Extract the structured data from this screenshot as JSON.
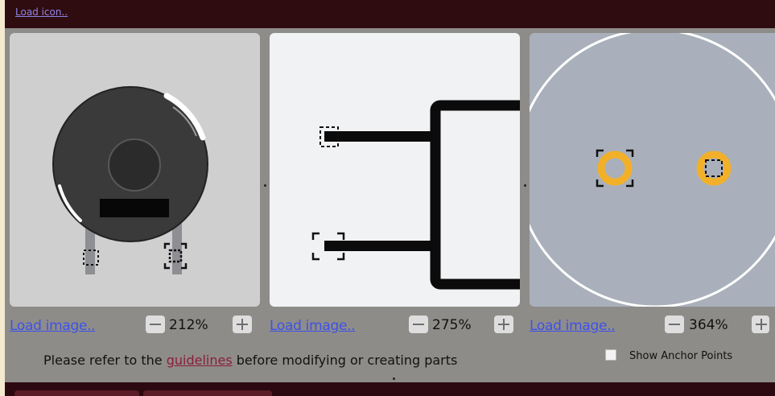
{
  "toolbar": {
    "load_icon_label": "Load icon.."
  },
  "views": [
    {
      "load_label": "Load image..",
      "zoom": "212%"
    },
    {
      "load_label": "Load image..",
      "zoom": "275%"
    },
    {
      "load_label": "Load image..",
      "zoom": "364%"
    }
  ],
  "footer": {
    "prefix": "Please refer to the",
    "link": "guidelines",
    "suffix": "before modifying or creating parts",
    "show_anchor_label": "Show Anchor Points",
    "show_anchor_checked": false
  },
  "colors": {
    "frame_dark": "#2f0c10",
    "link_blue": "#3d52e8",
    "guideline_link": "#8b1e3a",
    "anchor_orange": "#f2b02a"
  }
}
